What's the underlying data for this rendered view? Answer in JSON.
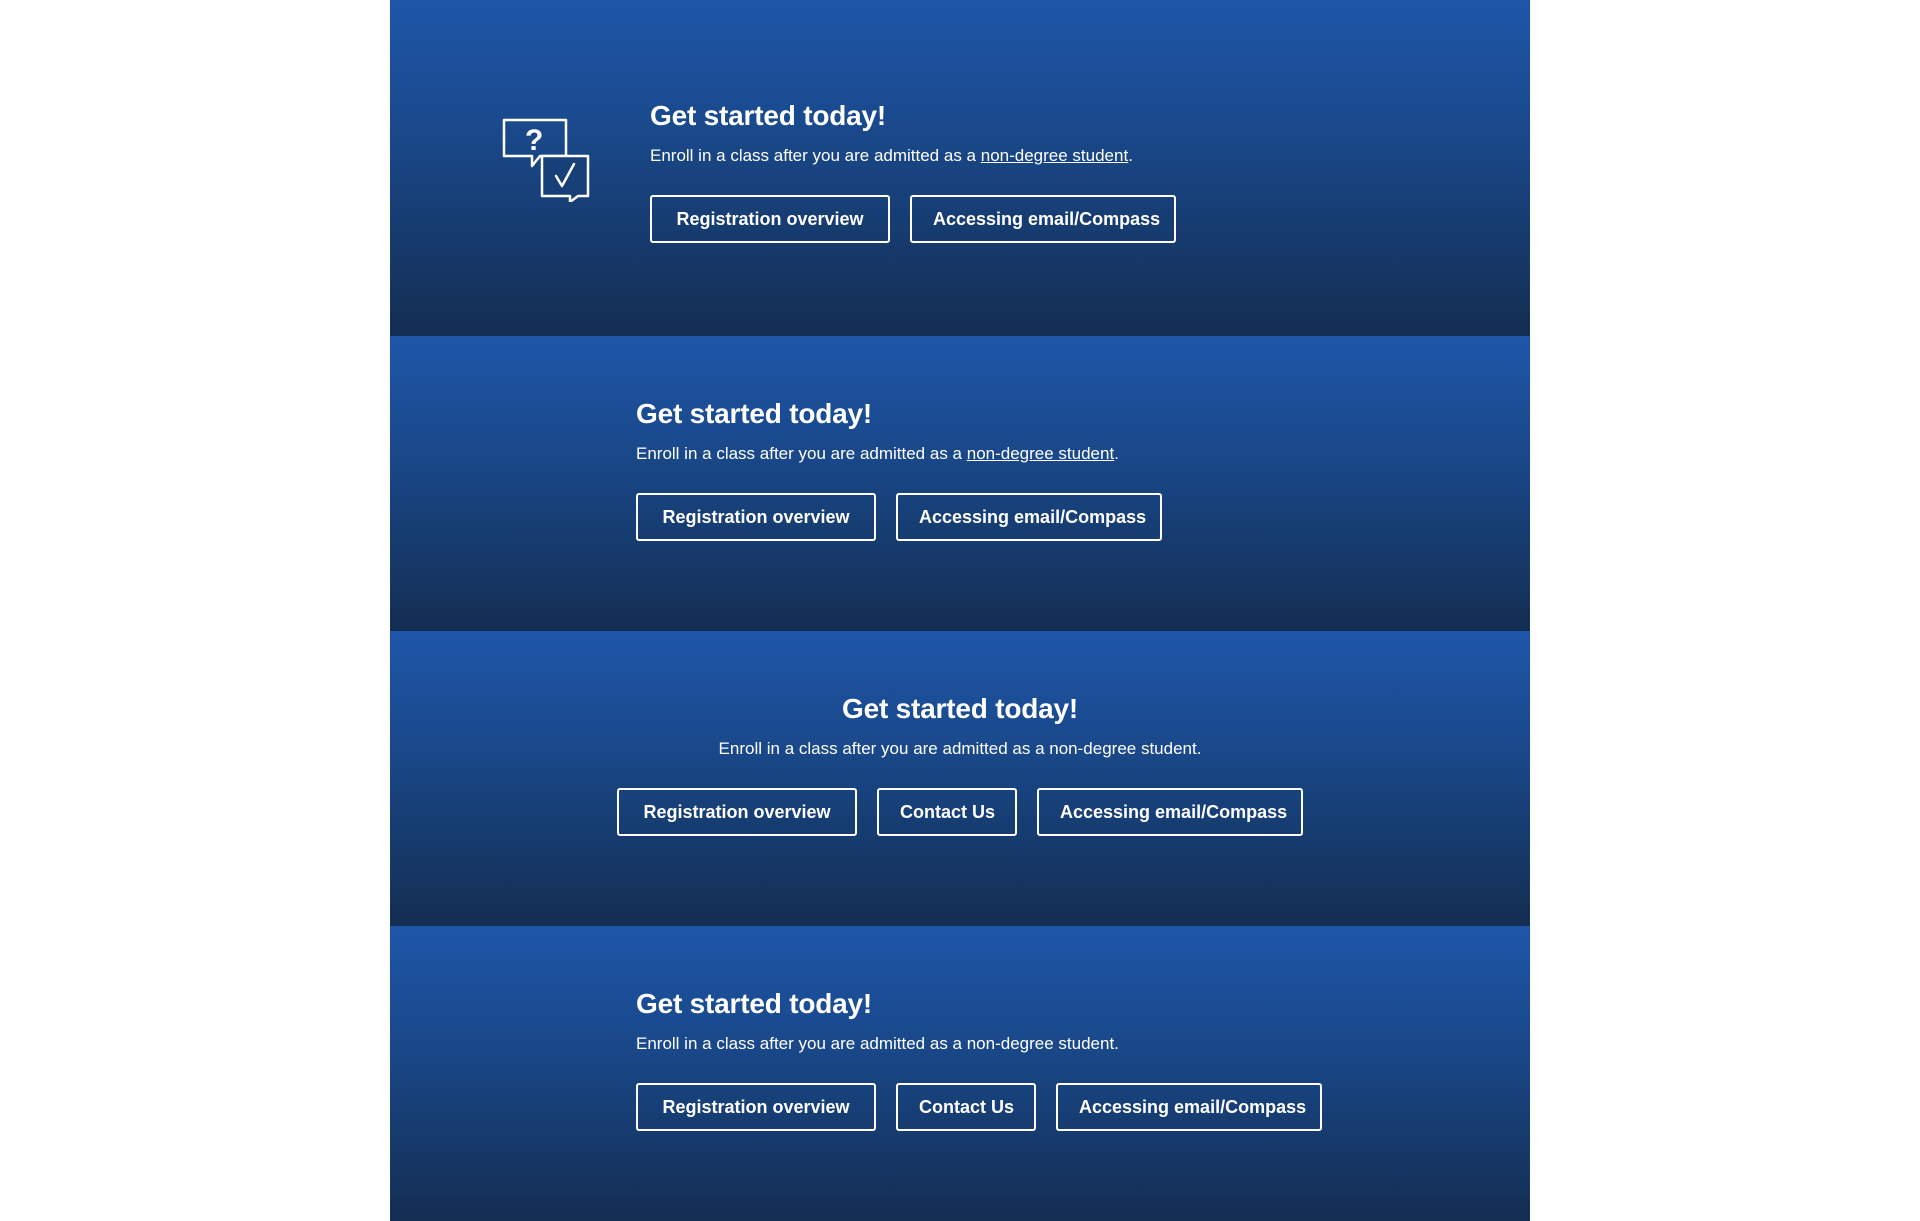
{
  "sections": [
    {
      "heading": "Get started today!",
      "desc_prefix": "Enroll in a class after you are admitted as a ",
      "desc_link": "non-degree student",
      "desc_suffix": ".",
      "icon": "question-check-chat-icon",
      "buttons": [
        "Registration overview",
        "Accessing email/Compass"
      ]
    },
    {
      "heading": "Get started today!",
      "desc_prefix": "Enroll in a class after you are admitted as a ",
      "desc_link": "non-degree student",
      "desc_suffix": ".",
      "buttons": [
        "Registration overview",
        "Accessing email/Compass"
      ]
    },
    {
      "heading": "Get started today!",
      "desc": "Enroll in a class after you are admitted as a non-degree student.",
      "buttons": [
        "Registration overview",
        "Contact Us",
        "Accessing email/Compass"
      ]
    },
    {
      "heading": "Get started today!",
      "desc": "Enroll in a class after you are admitted as a non-degree student.",
      "buttons": [
        "Registration overview",
        "Contact Us",
        "Accessing email/Compass"
      ]
    }
  ],
  "colors": {
    "band_top": "#1e56a8",
    "band_bottom": "#142d52",
    "text": "#ffffff",
    "page_bg": "#ffffff"
  }
}
